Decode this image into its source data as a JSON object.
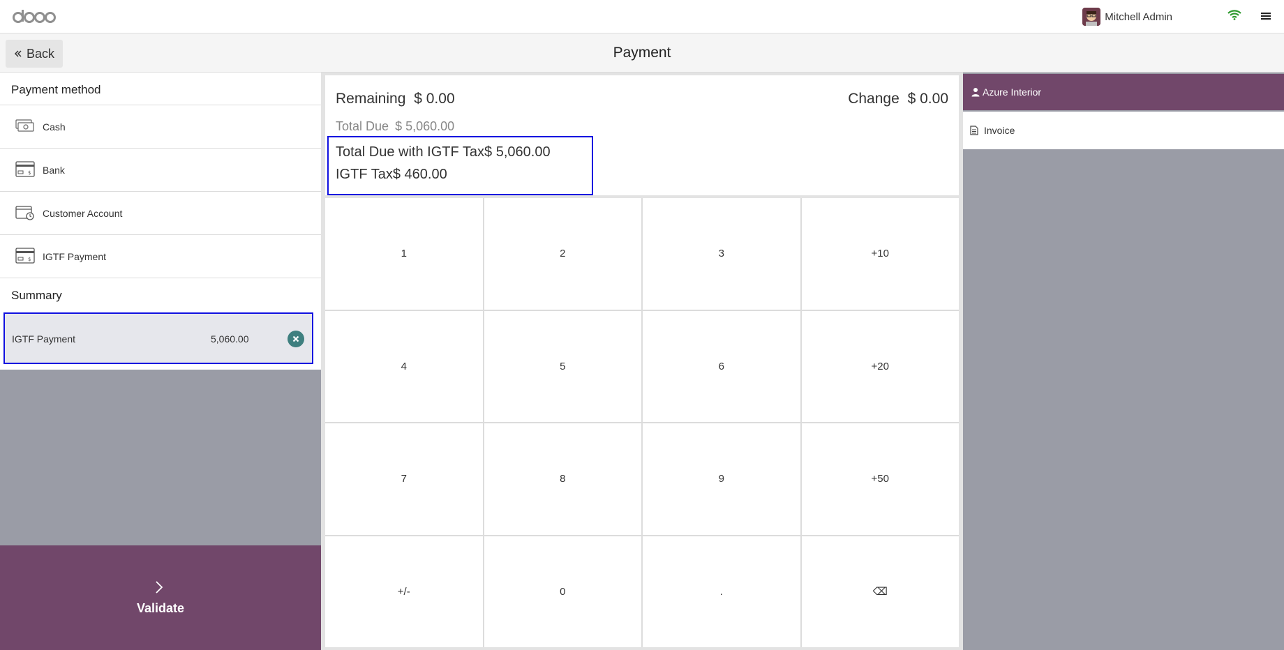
{
  "navbar": {
    "logo_text": "odoo",
    "user_name": "Mitchell Admin",
    "icons": [
      "avatar",
      "wifi-icon",
      "menu-icon"
    ]
  },
  "controlbar": {
    "back_label": "Back",
    "title": "Payment"
  },
  "left": {
    "payment_method_title": "Payment method",
    "payment_methods": [
      {
        "label": "Cash",
        "icon": "cash-icon"
      },
      {
        "label": "Bank",
        "icon": "bank-card-icon"
      },
      {
        "label": "Customer Account",
        "icon": "customer-account-icon"
      },
      {
        "label": "IGTF Payment",
        "icon": "bank-card-icon"
      }
    ],
    "summary_title": "Summary",
    "summary_lines": [
      {
        "name": "IGTF Payment",
        "amount": "5,060.00"
      }
    ],
    "validate_label": "Validate"
  },
  "status": {
    "remaining_label": "Remaining",
    "remaining_value": "$ 0.00",
    "change_label": "Change",
    "change_value": "$ 0.00",
    "total_due_label": "Total Due",
    "total_due_value": "$ 5,060.00",
    "igtf_total_label": "Total Due with IGTF Tax",
    "igtf_total_value": "$ 5,060.00",
    "igtf_tax_label": "IGTF Tax",
    "igtf_tax_value": "$ 460.00"
  },
  "numpad": [
    "1",
    "2",
    "3",
    "+10",
    "4",
    "5",
    "6",
    "+20",
    "7",
    "8",
    "9",
    "+50",
    "+/-",
    "0",
    ".",
    "⌫"
  ],
  "right": {
    "customer_label": "Azure Interior",
    "invoice_label": "Invoice"
  },
  "colors": {
    "brand": "#71476a",
    "highlight_border": "#1010e0",
    "delete_button": "#3e7f7f",
    "panel_grey": "#9a9ca6"
  }
}
